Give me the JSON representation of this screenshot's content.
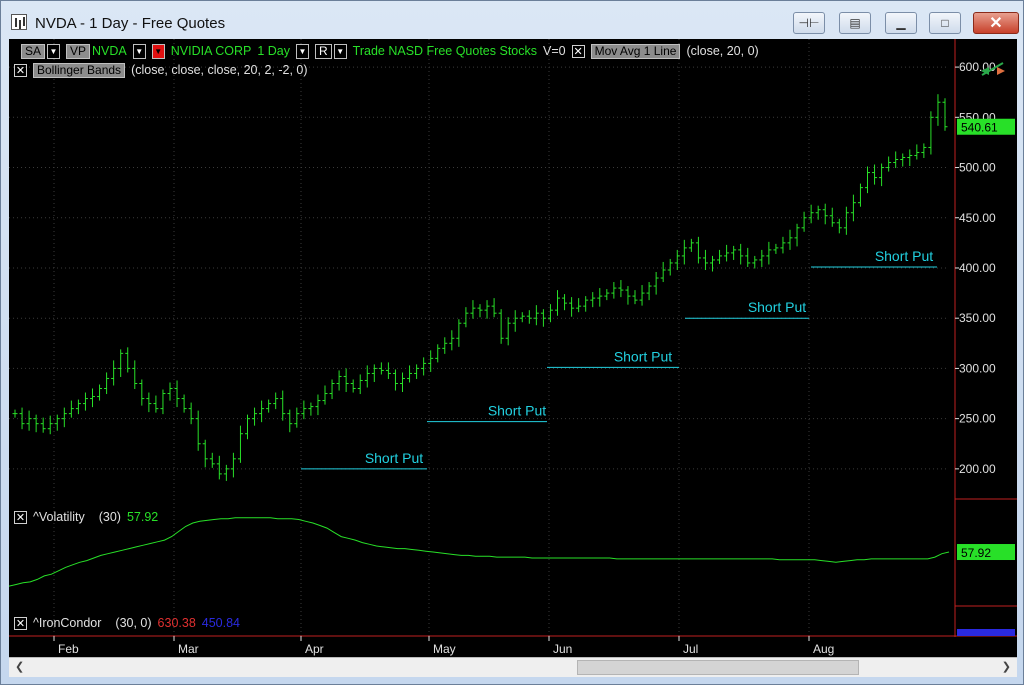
{
  "window": {
    "title": "NVDA - 1 Day - Free Quotes"
  },
  "toolbar": {
    "sa_label": "SA",
    "vp_label": "VP",
    "symbol": "NVDA",
    "company": "NVIDIA CORP",
    "interval": "1 Day",
    "r_label": "R",
    "info": "Trade  NASD  Free Quotes  Stocks",
    "v_value": "V=0",
    "mov_avg_label": "Mov Avg 1 Line",
    "mov_avg_params": "(close,  20,  0)",
    "bollinger_label": "Bollinger Bands",
    "bollinger_params": "(close,  close,  close,  20,  2,  -2,  0)"
  },
  "volatility": {
    "label": "^Volatility",
    "params": "(30)",
    "value": "57.92"
  },
  "iron_condor": {
    "label": "^IronCondor",
    "params": "(30,  0)",
    "value_red": "630.38",
    "value_blue": "450.84"
  },
  "colors": {
    "price": "#28e028",
    "short_put": "#22d0e0",
    "axis_red": "#c02020",
    "bg": "#000000"
  },
  "chart_data": {
    "type": "ohlc",
    "symbol": "NVDA",
    "ylim": [
      170,
      620
    ],
    "yticks": [
      200,
      250,
      300,
      350,
      400,
      450,
      500,
      550,
      600
    ],
    "ytick_labels": [
      "200.00",
      "250.00",
      "300.00",
      "350.00",
      "400.00",
      "450.00",
      "500.00",
      "550.00",
      "600.00"
    ],
    "last_price_label": "540.61",
    "months": [
      "Feb",
      "Mar",
      "Apr",
      "May",
      "Jun",
      "Jul",
      "Aug"
    ],
    "closes": [
      255,
      245,
      250,
      245,
      240,
      245,
      250,
      255,
      260,
      265,
      270,
      272,
      280,
      290,
      300,
      315,
      300,
      285,
      270,
      265,
      260,
      275,
      280,
      270,
      260,
      250,
      225,
      210,
      205,
      195,
      200,
      210,
      235,
      250,
      255,
      260,
      265,
      270,
      255,
      245,
      255,
      260,
      262,
      268,
      275,
      285,
      292,
      285,
      280,
      288,
      295,
      300,
      298,
      295,
      285,
      290,
      295,
      300,
      305,
      310,
      320,
      325,
      330,
      345,
      355,
      360,
      358,
      362,
      355,
      330,
      345,
      350,
      352,
      350,
      355,
      350,
      358,
      370,
      365,
      360,
      362,
      368,
      370,
      372,
      375,
      380,
      378,
      372,
      368,
      375,
      382,
      390,
      398,
      405,
      412,
      420,
      425,
      410,
      405,
      408,
      412,
      415,
      418,
      412,
      405,
      408,
      412,
      418,
      420,
      425,
      430,
      440,
      450,
      455,
      458,
      452,
      445,
      440,
      455,
      465,
      480,
      495,
      490,
      500,
      505,
      508,
      510,
      512,
      515,
      520,
      550,
      565,
      540.61
    ],
    "short_puts": [
      {
        "label": "Short Put",
        "price": 200
      },
      {
        "label": "Short Put",
        "price": 247
      },
      {
        "label": "Short Put",
        "price": 301
      },
      {
        "label": "Short Put",
        "price": 350
      },
      {
        "label": "Short Put",
        "price": 401
      }
    ],
    "volatility_series": [
      22,
      24,
      26,
      27,
      30,
      34,
      36,
      40,
      44,
      47,
      50,
      52,
      55,
      58,
      60,
      62,
      64,
      66,
      68,
      70,
      72,
      74,
      76,
      80,
      86,
      92,
      96,
      98,
      99,
      100,
      101,
      101,
      102,
      102,
      102,
      102,
      102,
      102,
      101,
      101,
      101,
      100,
      98,
      96,
      93,
      90,
      85,
      80,
      78,
      76,
      73,
      71,
      69,
      68,
      67,
      66,
      66,
      65,
      64,
      63,
      62,
      61,
      60,
      59,
      58,
      58,
      57,
      57,
      57,
      56,
      56,
      56,
      56,
      56,
      55,
      55,
      55,
      55,
      55,
      55,
      55,
      55,
      55,
      55,
      55,
      55,
      54,
      54,
      54,
      54,
      54,
      54,
      54,
      54,
      54,
      54,
      54,
      54,
      54,
      54,
      54,
      54,
      54,
      54,
      54,
      54,
      54,
      54,
      54,
      53,
      53,
      53,
      53,
      53,
      53,
      52,
      51,
      50,
      51,
      52,
      53,
      53,
      54,
      54,
      54,
      54,
      54,
      54,
      54,
      54,
      54,
      56,
      60,
      62
    ]
  }
}
